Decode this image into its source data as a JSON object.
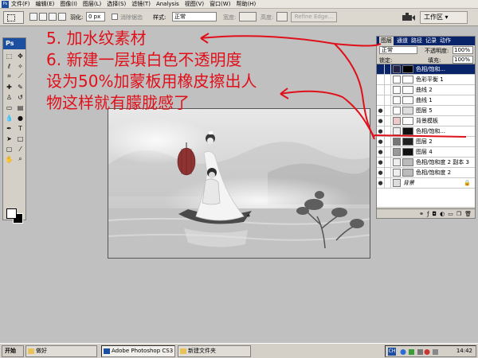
{
  "menubar": {
    "items": [
      "文件(F)",
      "编辑(E)",
      "图像(I)",
      "图层(L)",
      "选择(S)",
      "滤镜(T)",
      "Analysis",
      "视图(V)",
      "窗口(W)",
      "帮助(H)"
    ]
  },
  "options": {
    "feather_label": "羽化:",
    "feather_value": "0 px",
    "antialias_label": "消除锯齿",
    "style_label": "样式:",
    "style_value": "正常",
    "width_label": "宽度:",
    "height_label": "高度:",
    "refine_edge_label": "Refine Edge...",
    "workspace_label": "工作区"
  },
  "toolbox": {
    "logo": "Ps"
  },
  "annotation": {
    "line1": "5. 加水纹素材",
    "line2": "6. 新建一层填白色不透明度",
    "line3": "设为50%加蒙板用橡皮擦出人",
    "line4": "物这样就有朦胧感了"
  },
  "layers_panel": {
    "tabs": [
      "图层",
      "通道",
      "路径",
      "记录",
      "动作"
    ],
    "blend_mode": "正常",
    "opacity_label": "不透明度:",
    "opacity_value": "100%",
    "lock_label": "锁定:",
    "fill_label": "填充:",
    "fill_value": "100%",
    "layers": [
      {
        "name": "色相/饱和...",
        "thumb": "#222244",
        "mask": "#000000",
        "eye": "",
        "selected": true
      },
      {
        "name": "色彩平衡 1",
        "thumb": "#ffffff",
        "mask": "#ffffff",
        "eye": ""
      },
      {
        "name": "曲线 2",
        "thumb": "#ffffff",
        "mask": "#ffffff",
        "eye": ""
      },
      {
        "name": "曲线 1",
        "thumb": "#ffffff",
        "mask": "#ffffff",
        "eye": ""
      },
      {
        "name": "图层 5",
        "thumb": "#ffffff",
        "mask": "#dddddd",
        "eye": "●"
      },
      {
        "name": "背景模板",
        "thumb": "#f0c8c8",
        "mask": "#ffffff",
        "eye": "●"
      },
      {
        "name": "色相/饱和...",
        "thumb": "#eeeeee",
        "mask": "#111111",
        "eye": "●"
      },
      {
        "name": "图层 2",
        "thumb": "#777777",
        "mask": "#222222",
        "eye": "●"
      },
      {
        "name": "图层 4",
        "thumb": "#999999",
        "mask": "#111111",
        "eye": "●"
      },
      {
        "name": "色相/饱和度 2 副本 3",
        "thumb": "#eeeeee",
        "mask": "#bbbbbb",
        "eye": "●"
      },
      {
        "name": "色相/饱和度 2",
        "thumb": "#eeeeee",
        "mask": "#bbbbbb",
        "eye": "●"
      },
      {
        "name": "背景",
        "thumb": "#dddddd",
        "mask": "",
        "eye": "●",
        "background": true
      }
    ]
  },
  "taskbar": {
    "start_label": "开始",
    "tasks": [
      "做好",
      "Adobe Photoshop CS3 E...",
      "新建文件夹"
    ],
    "tray_ime": "CH",
    "clock": "14:42"
  },
  "colors": {
    "annotation": "#e0101a",
    "selection": "#0a246a"
  }
}
